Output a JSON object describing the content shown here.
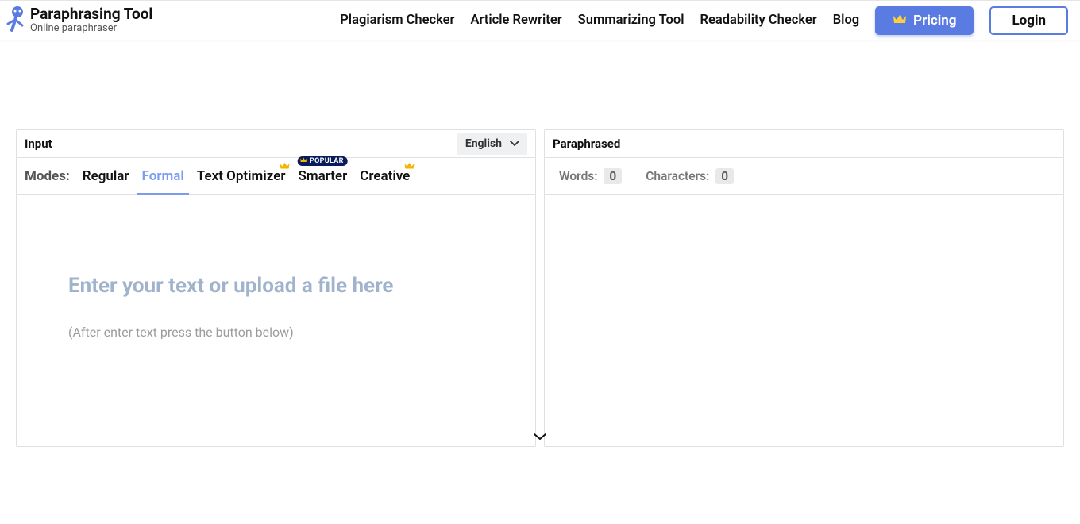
{
  "brand": {
    "title": "Paraphrasing Tool",
    "subtitle": "Online paraphraser"
  },
  "nav": {
    "links": [
      "Plagiarism Checker",
      "Article Rewriter",
      "Summarizing Tool",
      "Readability Checker",
      "Blog"
    ],
    "pricing": "Pricing",
    "login": "Login"
  },
  "input_panel": {
    "title": "Input",
    "language": "English",
    "modes_label": "Modes:",
    "modes": [
      {
        "label": "Regular",
        "active": false
      },
      {
        "label": "Formal",
        "active": true
      },
      {
        "label": "Text Optimizer",
        "active": false,
        "crown": true
      },
      {
        "label": "Smarter",
        "active": false,
        "popular": true,
        "popular_label": "POPULAR"
      },
      {
        "label": "Creative",
        "active": false,
        "crown": true
      }
    ],
    "placeholder": "Enter your text or upload a file here",
    "hint": "(After enter text press the button below)"
  },
  "output_panel": {
    "title": "Paraphrased",
    "words_label": "Words:",
    "words_value": "0",
    "chars_label": "Characters:",
    "chars_value": "0"
  }
}
